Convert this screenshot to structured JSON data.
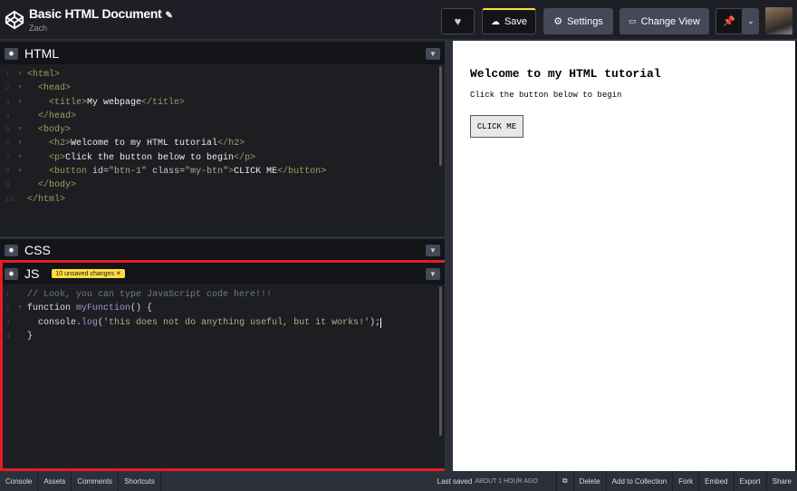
{
  "header": {
    "title": "Basic HTML Document",
    "author": "Zach",
    "save": "Save",
    "settings": "Settings",
    "change_view": "Change View"
  },
  "panels": {
    "html": "HTML",
    "css": "CSS",
    "js": "JS",
    "js_badge": "10 unsaved changes"
  },
  "html_code": [
    [
      [
        "tag",
        "<html>"
      ]
    ],
    [
      [
        "plain",
        "  "
      ],
      [
        "tag",
        "<head>"
      ]
    ],
    [
      [
        "plain",
        "    "
      ],
      [
        "tag",
        "<title>"
      ],
      [
        "text",
        "My webpage"
      ],
      [
        "tag",
        "</title>"
      ]
    ],
    [
      [
        "plain",
        "  "
      ],
      [
        "tag",
        "</head>"
      ]
    ],
    [
      [
        "plain",
        "  "
      ],
      [
        "tag",
        "<body>"
      ]
    ],
    [
      [
        "plain",
        "    "
      ],
      [
        "tag",
        "<h2>"
      ],
      [
        "text",
        "Welcome to my HTML tutorial"
      ],
      [
        "tag",
        "</h2>"
      ]
    ],
    [
      [
        "plain",
        "    "
      ],
      [
        "tag",
        "<p>"
      ],
      [
        "text",
        "Click the button below to begin"
      ],
      [
        "tag",
        "</p>"
      ]
    ],
    [
      [
        "plain",
        "    "
      ],
      [
        "tag",
        "<button "
      ],
      [
        "attr",
        "id="
      ],
      [
        "str",
        "\"btn-1\""
      ],
      [
        "attr",
        " class="
      ],
      [
        "str",
        "\"my-btn\""
      ],
      [
        "tag",
        ">"
      ],
      [
        "text",
        "CLICK ME"
      ],
      [
        "tag",
        "</button>"
      ]
    ],
    [
      [
        "plain",
        "  "
      ],
      [
        "tag",
        "</body>"
      ]
    ],
    [
      [
        "tag",
        "</html>"
      ]
    ]
  ],
  "js_code": [
    [
      [
        "comment",
        "// Look, you can type JavaScript code here!!!"
      ]
    ],
    [
      [
        "kw",
        "function "
      ],
      [
        "fn",
        "myFunction"
      ],
      [
        "plain",
        "() {"
      ]
    ],
    [
      [
        "plain",
        "  console."
      ],
      [
        "fn",
        "log"
      ],
      [
        "plain",
        "("
      ],
      [
        "str",
        "'this does not do anything useful, but it works!'"
      ],
      [
        "plain",
        ");"
      ]
    ],
    [
      [
        "plain",
        "}"
      ]
    ]
  ],
  "preview": {
    "heading": "Welcome to my HTML tutorial",
    "paragraph": "Click the button below to begin",
    "button": "CLICK ME"
  },
  "footer": {
    "left": [
      "Console",
      "Assets",
      "Comments",
      "Shortcuts"
    ],
    "last_saved_label": "Last saved",
    "last_saved_value": "ABOUT 1 HOUR AGO",
    "right": [
      "Delete",
      "Add to Collection",
      "Fork",
      "Embed",
      "Export",
      "Share"
    ]
  }
}
